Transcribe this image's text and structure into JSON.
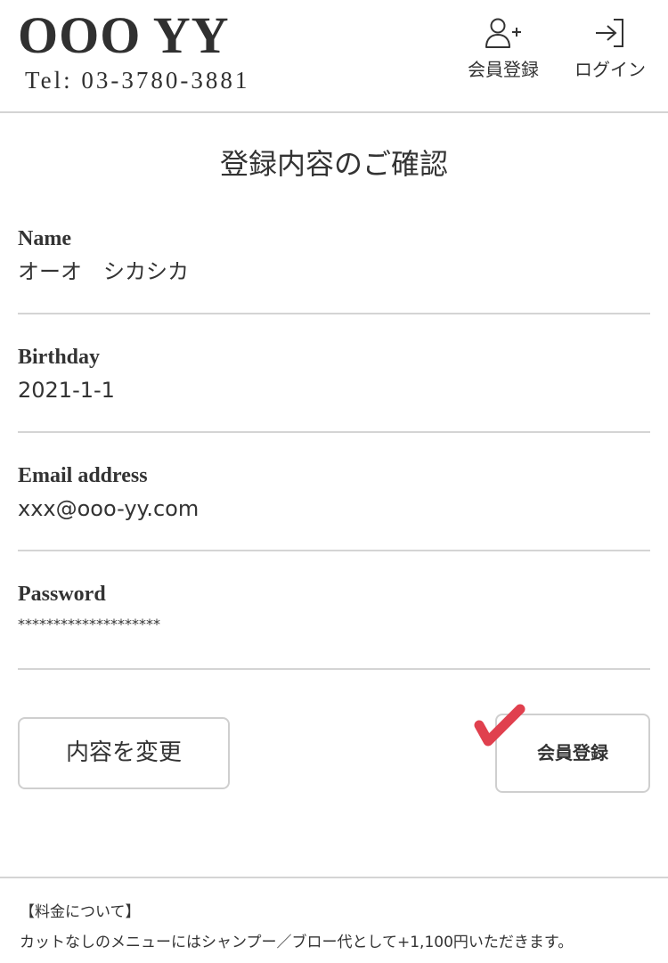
{
  "header": {
    "brand": "OOO YY",
    "tel": "Tel: 03-3780-3881",
    "nav": {
      "register_label": "会員登録",
      "login_label": "ログイン"
    }
  },
  "page_title": "登録内容のご確認",
  "fields": [
    {
      "label": "Name",
      "value": "オーオ　シカシカ"
    },
    {
      "label": "Birthday",
      "value": "2021-1-1"
    },
    {
      "label": "Email address",
      "value": "xxx@ooo-yy.com"
    },
    {
      "label": "Password",
      "value": "********************"
    }
  ],
  "actions": {
    "edit_label": "内容を変更",
    "register_label": "会員登録"
  },
  "footer": {
    "fee_title": "【料金について】",
    "fee_text": "カットなしのメニューにはシャンプー／ブロー代として+1,100円いただきます。"
  },
  "colors": {
    "text": "#333333",
    "divider": "#d4d4d4",
    "check_mark": "#e0404e"
  },
  "icons": {
    "register": "add-user-icon",
    "login": "login-arrow-icon",
    "annotation": "check-mark-icon"
  }
}
